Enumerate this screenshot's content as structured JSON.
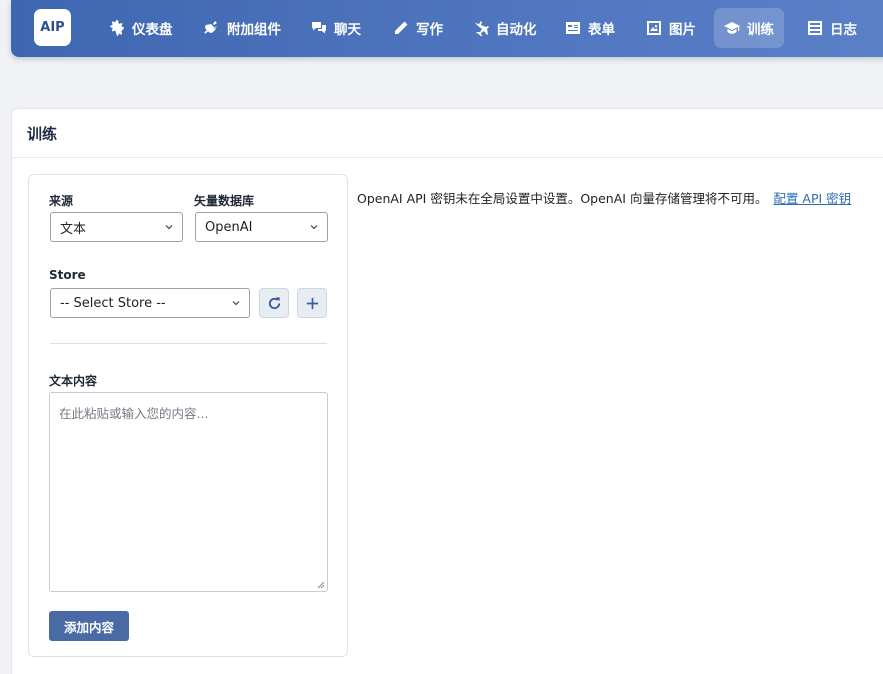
{
  "app": {
    "logo_text": "AIP"
  },
  "nav": {
    "items": [
      {
        "label": "仪表盘",
        "icon": "gear-icon"
      },
      {
        "label": "附加组件",
        "icon": "plug-icon"
      },
      {
        "label": "聊天",
        "icon": "chat-icon"
      },
      {
        "label": "写作",
        "icon": "pencil-icon"
      },
      {
        "label": "自动化",
        "icon": "automation-icon"
      },
      {
        "label": "表单",
        "icon": "form-icon"
      },
      {
        "label": "图片",
        "icon": "image-icon"
      },
      {
        "label": "训练",
        "icon": "graduation-cap-icon",
        "active": true
      },
      {
        "label": "日志",
        "icon": "list-icon"
      }
    ]
  },
  "page": {
    "title": "训练"
  },
  "form": {
    "source_label": "来源",
    "source_value": "文本",
    "vector_db_label": "矢量数据库",
    "vector_db_value": "OpenAI",
    "store_label": "Store",
    "store_value": "-- Select Store --",
    "content_label": "文本内容",
    "content_placeholder": "在此粘贴或输入您的内容...",
    "add_button": "添加内容"
  },
  "notice": {
    "text": "OpenAI API 密钥未在全局设置中设置。OpenAI 向量存储管理将不可用。",
    "link": "配置 API 密钥"
  },
  "colors": {
    "nav_gradient_start": "#3f66b0",
    "nav_gradient_end": "#5a80c8",
    "primary_button": "#4a6aa5",
    "link": "#2b6cb0"
  }
}
